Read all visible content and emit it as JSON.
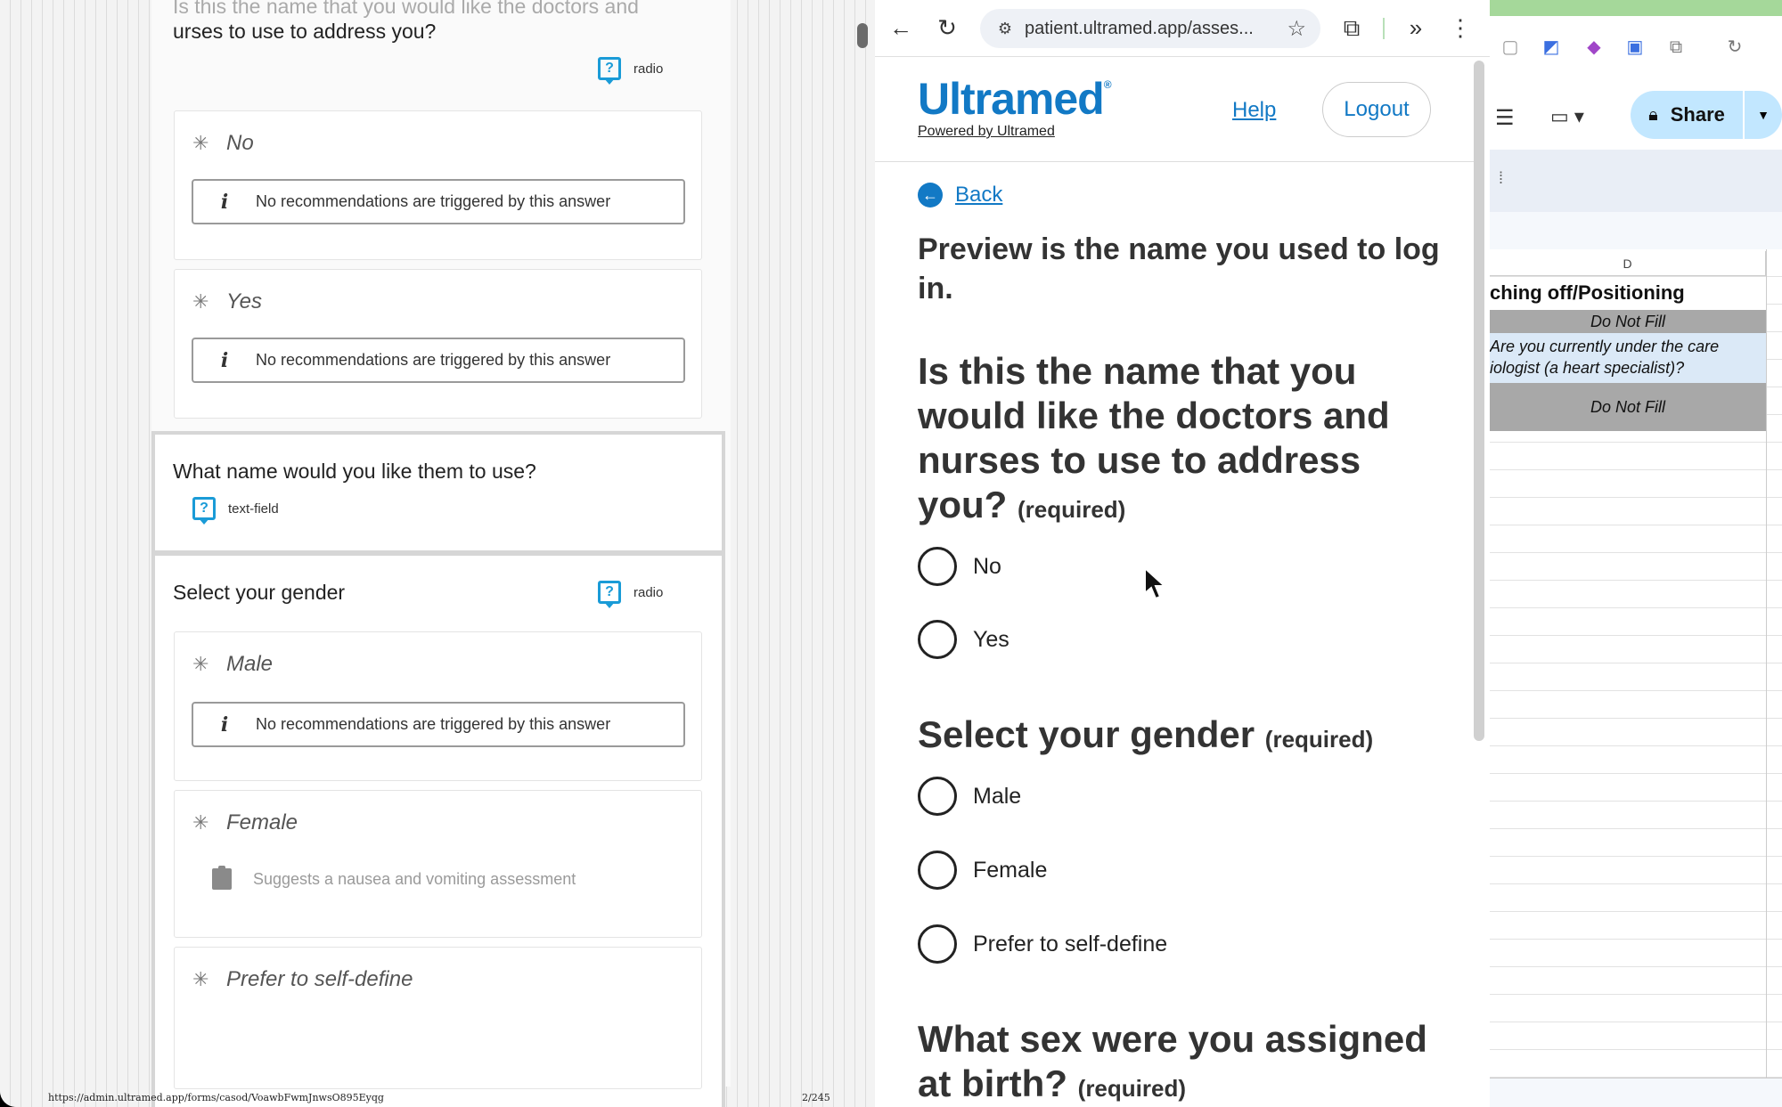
{
  "left": {
    "cut_title": "Is this the name that you would like the doctors and",
    "q1_title_tail": "urses to use to address you?",
    "q1_type": "radio",
    "answers_q1": [
      {
        "label": "No",
        "recommendation": "No recommendations are triggered by this answer"
      },
      {
        "label": "Yes",
        "recommendation": "No recommendations are triggered by this answer"
      }
    ],
    "q2_title": "What name would you like them to use?",
    "q2_type": "text-field",
    "q3_title": "Select your gender",
    "q3_type": "radio",
    "answers_q3": [
      {
        "label": "Male",
        "recommendation": "No recommendations are triggered by this answer"
      },
      {
        "label": "Female",
        "suggestion": "Suggests a nausea and vomiting assessment"
      },
      {
        "label": "Prefer to self-define"
      }
    ],
    "status_url": "https://admin.ultramed.app/forms/casod/VoawbFwmJnwsO895Eyqg",
    "status_page": "2/245"
  },
  "browser": {
    "url": "patient.ultramed.app/asses...",
    "icons": {
      "back": "arrow-left-icon",
      "reload": "reload-icon",
      "site_info": "tune-icon",
      "bookmark": "star-icon",
      "extensions": "puzzle-icon",
      "more": "chevron-double-right-icon",
      "menu": "kebab-icon"
    }
  },
  "app": {
    "logo": "Ultramed",
    "logo_mark": "®",
    "powered": "Powered by Ultramed",
    "help": "Help",
    "logout": "Logout",
    "back": "Back",
    "preview_note": "Preview is the name you used to log in.",
    "required": "(required)",
    "q1": "Is this the name that you would like the doctors and nurses to use to address you?",
    "q1_options": [
      "No",
      "Yes"
    ],
    "q2": "Select your gender",
    "q2_options": [
      "Male",
      "Female",
      "Prefer to self-define"
    ],
    "q3": "What sex were you assigned at birth?",
    "colors": {
      "brand": "#1279c5"
    }
  },
  "sheet": {
    "column": "D",
    "header_cell": "ching off/Positioning",
    "row1": "Do Not Fill",
    "row2_line1": " Are you currently under the care",
    "row2_line2": "iologist (a heart specialist)?",
    "row3": "Do Not Fill",
    "share": "Share",
    "colors": {
      "share_bg": "#c2e7ff"
    }
  }
}
